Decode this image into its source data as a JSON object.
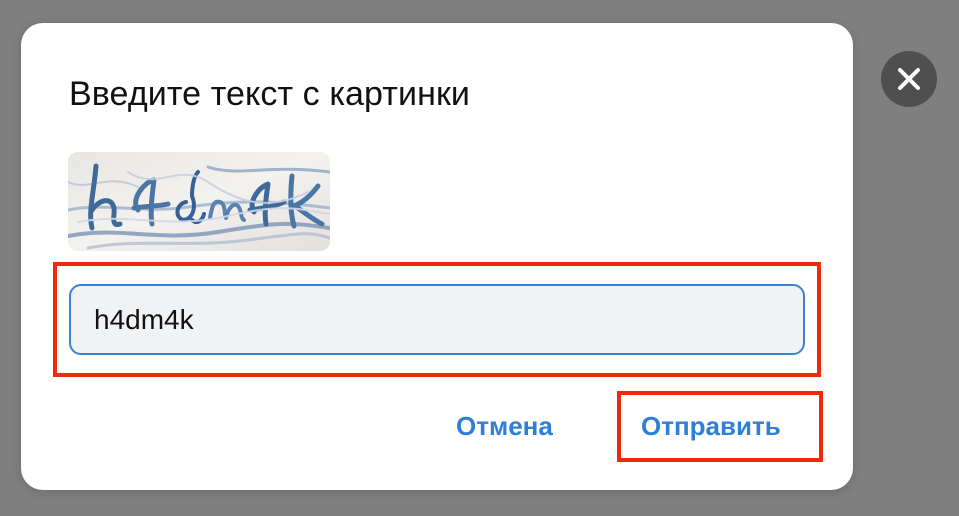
{
  "dialog": {
    "title": "Введите текст с картинки",
    "captcha_alt": "captcha image",
    "input": {
      "value": "h4dm4k",
      "placeholder": ""
    },
    "cancel_label": "Отмена",
    "submit_label": "Отправить"
  },
  "close_button": {
    "icon": "close-icon",
    "label": "Close"
  },
  "colors": {
    "overlay": "#7f7f7f",
    "accent": "#2f7ed8",
    "highlight": "#ee2a0b",
    "close_bg": "#4f4f4f"
  }
}
